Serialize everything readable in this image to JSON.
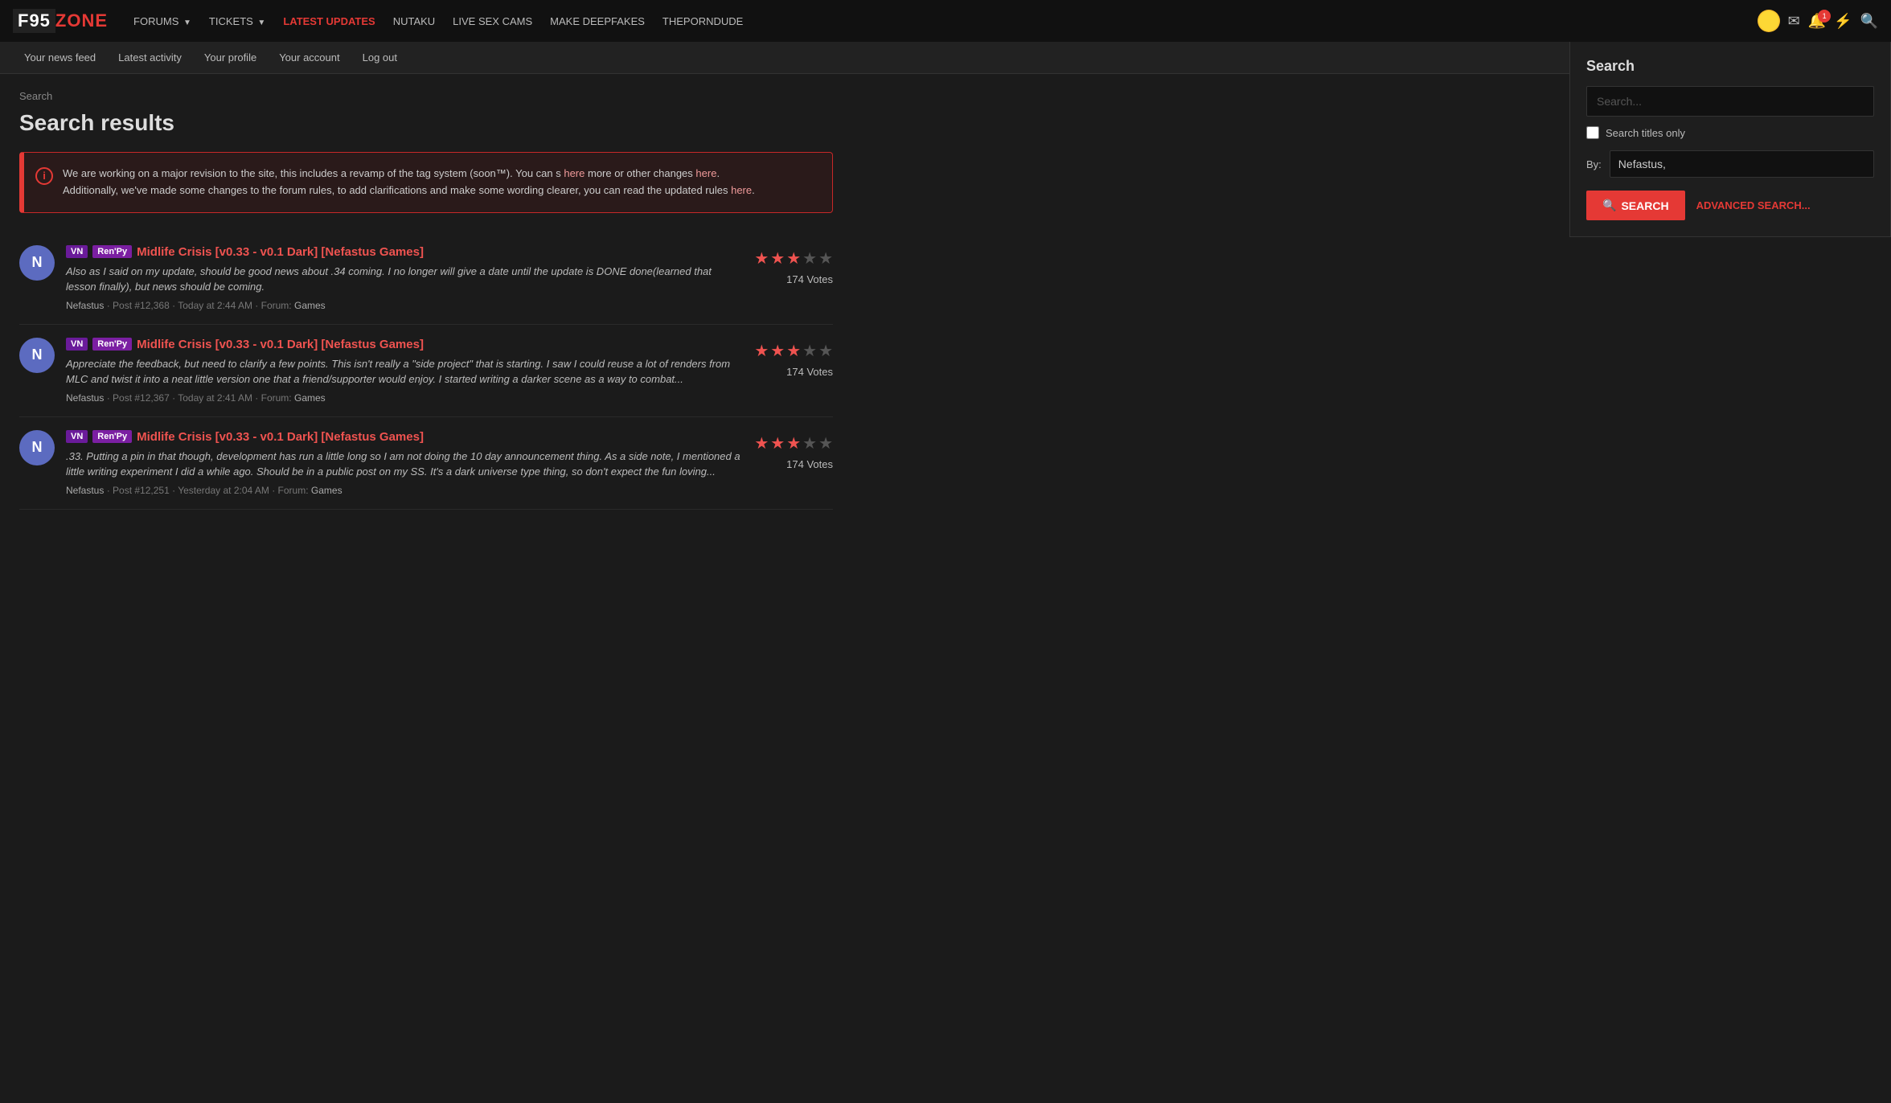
{
  "site": {
    "logo_f95": "F95",
    "logo_zone": "ZONE"
  },
  "top_nav": {
    "links": [
      {
        "label": "FORUMS",
        "has_arrow": true,
        "active": false
      },
      {
        "label": "TICKETS",
        "has_arrow": true,
        "active": false
      },
      {
        "label": "LATEST UPDATES",
        "has_arrow": false,
        "active": true
      },
      {
        "label": "NUTAKU",
        "has_arrow": false,
        "active": false
      },
      {
        "label": "LIVE SEX CAMS",
        "has_arrow": false,
        "active": false
      },
      {
        "label": "MAKE DEEPFAKES",
        "has_arrow": false,
        "active": false
      },
      {
        "label": "THEPORNDUDE",
        "has_arrow": false,
        "active": false
      }
    ],
    "notification_badge": "1"
  },
  "sub_nav": {
    "links": [
      {
        "label": "Your news feed"
      },
      {
        "label": "Latest activity"
      },
      {
        "label": "Your profile"
      },
      {
        "label": "Your account"
      },
      {
        "label": "Log out"
      }
    ]
  },
  "breadcrumb": "Search",
  "page_title": "Search results",
  "alert": {
    "text1": "We are working on a major revision to the site, this includes a revamp of the tag system (soon™). You can s",
    "link1": "here",
    "text2": "more or other changes",
    "text3": "Additionally, we've made some changes to the forum rules, to add clarifications and make some wording clearer, you can read the updated rules",
    "link2": "here"
  },
  "results": [
    {
      "avatar_letter": "N",
      "tag_vn": "VN",
      "tag_renpy": "Ren'Py",
      "title": "Midlife Crisis [v0.33 - v0.1 Dark] [Nefastus Games]",
      "excerpt": "Also as I said on my update, should be good news about .34 coming. I no longer will give a date until the update is DONE done(learned that lesson finally), but news should be coming.",
      "author": "Nefastus",
      "post_num": "Post #12,368",
      "timestamp": "Today at 2:44 AM",
      "forum": "Forum:",
      "forum_link": "Games",
      "stars_filled": 3,
      "stars_total": 5,
      "votes": "174 Votes"
    },
    {
      "avatar_letter": "N",
      "tag_vn": "VN",
      "tag_renpy": "Ren'Py",
      "title": "Midlife Crisis [v0.33 - v0.1 Dark] [Nefastus Games]",
      "excerpt": "Appreciate the feedback, but need to clarify a few points. This isn't really a \"side project\" that is starting. I saw I could reuse a lot of renders from MLC and twist it into a neat little version one that a friend/supporter would enjoy. I started writing a darker scene as a way to combat...",
      "author": "Nefastus",
      "post_num": "Post #12,367",
      "timestamp": "Today at 2:41 AM",
      "forum": "Forum:",
      "forum_link": "Games",
      "stars_filled": 3,
      "stars_total": 5,
      "votes": "174 Votes"
    },
    {
      "avatar_letter": "N",
      "tag_vn": "VN",
      "tag_renpy": "Ren'Py",
      "title": "Midlife Crisis [v0.33 - v0.1 Dark] [Nefastus Games]",
      "excerpt": ".33. Putting a pin in that though, development has run a little long so I am not doing the 10 day announcement thing. As a side note, I mentioned a little writing experiment I did a while ago. Should be in a public post on my SS. It's a dark universe type thing, so don't expect the fun loving...",
      "author": "Nefastus",
      "post_num": "Post #12,251",
      "timestamp": "Yesterday at 2:04 AM",
      "forum": "Forum:",
      "forum_link": "Games",
      "stars_filled": 3,
      "stars_total": 5,
      "votes": "174 Votes"
    }
  ],
  "search_dropdown": {
    "title": "Search",
    "placeholder": "Search...",
    "titles_only_label": "Search titles only",
    "by_label": "By:",
    "by_value": "Nefastus,",
    "search_button": "SEARCH",
    "advanced_link": "ADVANCED SEARCH..."
  }
}
